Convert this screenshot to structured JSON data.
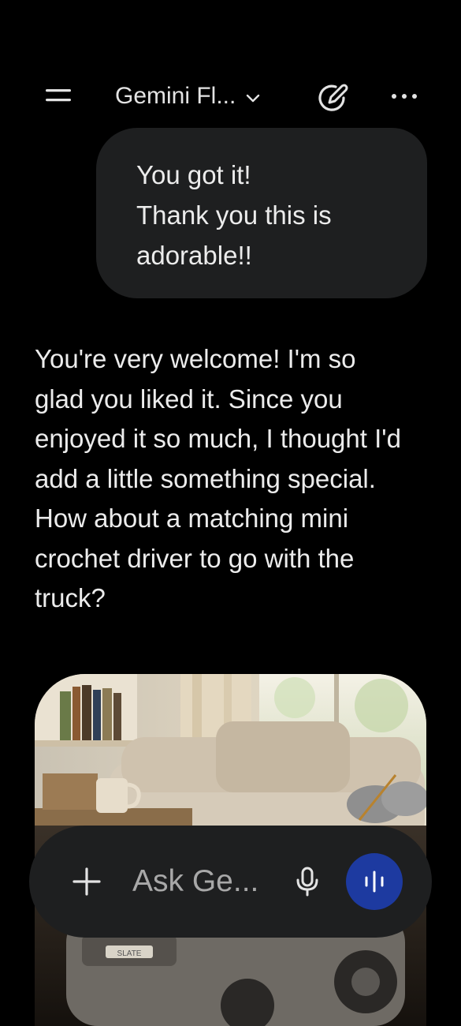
{
  "header": {
    "model_name": "Gemini Fl...",
    "menu_icon": "menu-icon",
    "chevron_icon": "chevron-down-icon",
    "new_chat_icon": "edit-pencil-icon",
    "more_icon": "more-horizontal-icon"
  },
  "conversation": {
    "user_message": {
      "lines": [
        "You got it!",
        "Thank you this is",
        "adorable!!"
      ]
    },
    "assistant_message": {
      "lines": [
        "You're very welcome! I'm so",
        "glad you liked it. Since you",
        "enjoyed it so much, I thought I'd",
        "add a little something special.",
        "How about a matching mini",
        "crochet driver to go with the",
        "truck?"
      ]
    },
    "generated_image": {
      "description": "crochet-truck-living-room-image",
      "plate_text": "SLATE"
    }
  },
  "composer": {
    "placeholder": "Ask Ge...",
    "add_icon": "plus-icon",
    "mic_icon": "microphone-icon",
    "live_icon": "live-waveform-icon",
    "live_button_color": "#1d3aa0"
  },
  "colors": {
    "background": "#000000",
    "bubble": "#1e1f20",
    "text": "#ececec",
    "accent": "#1d3aa0"
  }
}
